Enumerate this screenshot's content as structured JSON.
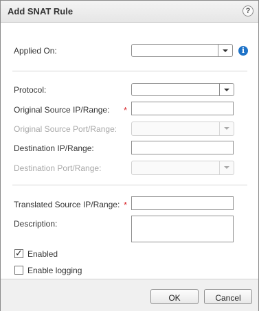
{
  "dialog": {
    "title": "Add SNAT Rule",
    "help_glyph": "?",
    "info_glyph": "i"
  },
  "form": {
    "applied_on_label": "Applied On:",
    "protocol_label": "Protocol:",
    "orig_src_ip_label": "Original Source IP/Range:",
    "orig_src_port_label": "Original Source Port/Range:",
    "dest_ip_label": "Destination IP/Range:",
    "dest_port_label": "Destination Port/Range:",
    "trans_src_ip_label": "Translated Source IP/Range:",
    "description_label": "Description:",
    "required_marker": "*",
    "enabled_label": "Enabled",
    "enabled_checked": true,
    "logging_label": "Enable logging",
    "logging_checked": false,
    "check_glyph": "✓"
  },
  "buttons": {
    "ok": "OK",
    "cancel": "Cancel"
  },
  "colors": {
    "required": "#d9262b",
    "info": "#1e73c8"
  }
}
